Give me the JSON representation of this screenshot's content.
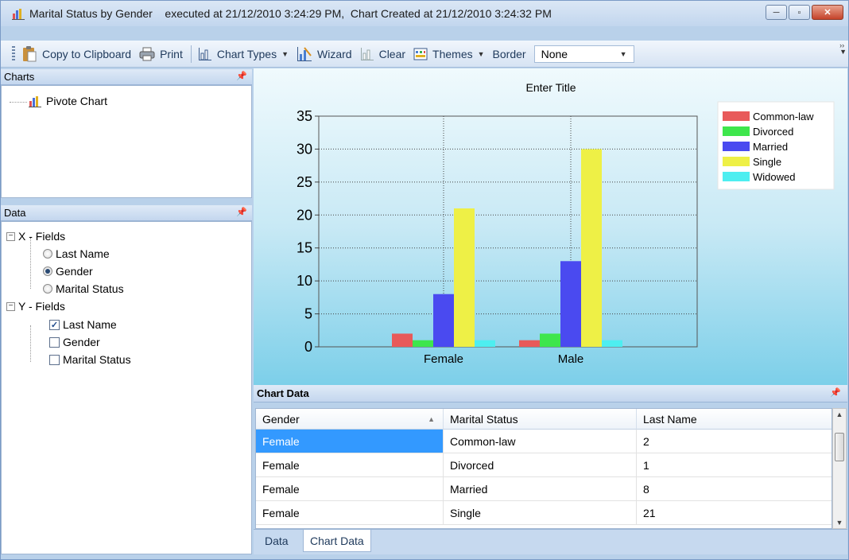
{
  "window": {
    "title": "Marital Status by Gender    executed at 21/12/2010 3:24:29 PM,  Chart Created at 21/12/2010 3:24:32 PM",
    "minimize": "─",
    "maximize": "▫",
    "close": "✕"
  },
  "toolbar": {
    "copy": "Copy to Clipboard",
    "print": "Print",
    "chart_types": "Chart Types",
    "wizard": "Wizard",
    "clear": "Clear",
    "themes": "Themes",
    "border": "Border",
    "border_value": "None"
  },
  "charts_panel": {
    "header": "Charts",
    "item": "Pivote Chart"
  },
  "data_panel": {
    "header": "Data",
    "x_group": "X - Fields",
    "x_items": [
      {
        "label": "Last Name",
        "selected": false
      },
      {
        "label": "Gender",
        "selected": true
      },
      {
        "label": "Marital Status",
        "selected": false
      }
    ],
    "y_group": "Y - Fields",
    "y_items": [
      {
        "label": "Last Name",
        "checked": true
      },
      {
        "label": "Gender",
        "checked": false
      },
      {
        "label": "Marital Status",
        "checked": false
      }
    ]
  },
  "chart_data": {
    "type": "bar",
    "title": "Enter Title",
    "categories": [
      "Female",
      "Male"
    ],
    "series": [
      {
        "name": "Common-law",
        "color": "#e85a5a",
        "values": [
          2,
          1
        ]
      },
      {
        "name": "Divorced",
        "color": "#3ee64c",
        "values": [
          1,
          2
        ]
      },
      {
        "name": "Married",
        "color": "#4a4af0",
        "values": [
          8,
          13
        ]
      },
      {
        "name": "Single",
        "color": "#eef046",
        "values": [
          21,
          30
        ]
      },
      {
        "name": "Widowed",
        "color": "#4eeef0",
        "values": [
          1,
          1
        ]
      }
    ],
    "ylim": [
      0,
      35
    ],
    "yticks": [
      "0",
      "5",
      "10",
      "15",
      "20",
      "25",
      "30",
      "35"
    ],
    "legend_position": "top-right",
    "grid": true
  },
  "chart_data_panel": {
    "header": "Chart Data",
    "columns": [
      "Gender",
      "Marital Status",
      "Last Name"
    ],
    "rows": [
      [
        "Female",
        "Common-law",
        "2"
      ],
      [
        "Female",
        "Divorced",
        "1"
      ],
      [
        "Female",
        "Married",
        "8"
      ],
      [
        "Female",
        "Single",
        "21"
      ]
    ]
  },
  "tabs": [
    "Data",
    "Chart Data"
  ]
}
